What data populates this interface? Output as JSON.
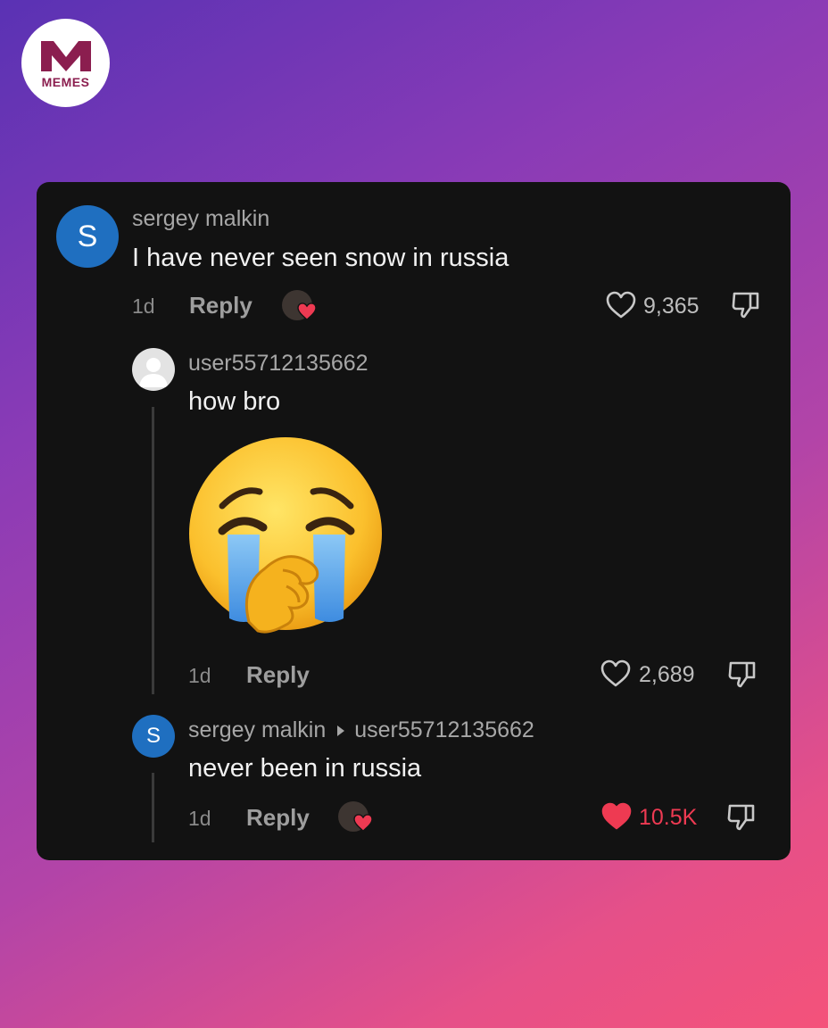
{
  "logo": {
    "text": "MEMES",
    "icon": "m-logo-icon",
    "color": "#8b1e4f"
  },
  "comments": [
    {
      "avatar_letter": "S",
      "username": "sergey malkin",
      "text": "I have never seen snow in russia",
      "time": "1d",
      "reply_label": "Reply",
      "likes": "9,365"
    },
    {
      "username": "user55712135662",
      "text": "how bro",
      "sticker": "loudly-crying-emoji",
      "time": "1d",
      "reply_label": "Reply",
      "likes": "2,689"
    },
    {
      "avatar_letter": "S",
      "username": "sergey malkin",
      "reply_to": "user55712135662",
      "text": "never been in russia",
      "time": "1d",
      "reply_label": "Reply",
      "likes": "10.5K",
      "liked": true
    }
  ],
  "colors": {
    "avatar_blue": "#1f6fc0",
    "like_red": "#ee3a52",
    "card_bg": "#121212"
  }
}
